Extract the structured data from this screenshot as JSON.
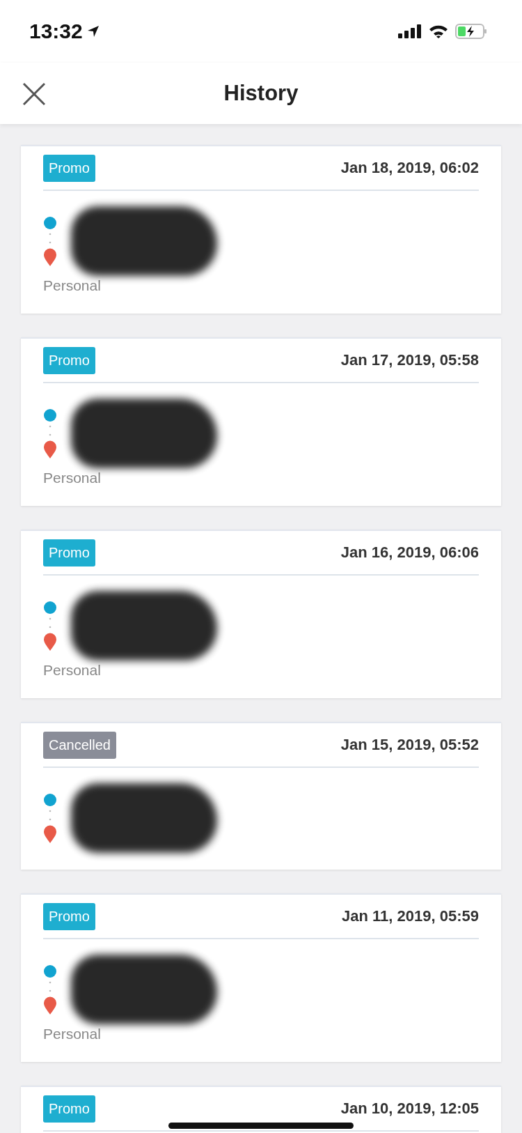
{
  "status_bar": {
    "time": "13:32"
  },
  "header": {
    "title": "History"
  },
  "trips": [
    {
      "tag": {
        "kind": "promo",
        "label": "Promo"
      },
      "date": "Jan 18, 2019, 06:02",
      "account": "Personal"
    },
    {
      "tag": {
        "kind": "promo",
        "label": "Promo"
      },
      "date": "Jan 17, 2019, 05:58",
      "account": "Personal"
    },
    {
      "tag": {
        "kind": "promo",
        "label": "Promo"
      },
      "date": "Jan 16, 2019, 06:06",
      "account": "Personal"
    },
    {
      "tag": {
        "kind": "cancelled",
        "label": "Cancelled"
      },
      "date": "Jan 15, 2019, 05:52"
    },
    {
      "tag": {
        "kind": "promo",
        "label": "Promo"
      },
      "date": "Jan 11, 2019, 05:59",
      "account": "Personal"
    },
    {
      "tag": {
        "kind": "promo",
        "label": "Promo"
      },
      "date": "Jan 10, 2019, 12:05",
      "partial": true
    }
  ]
}
